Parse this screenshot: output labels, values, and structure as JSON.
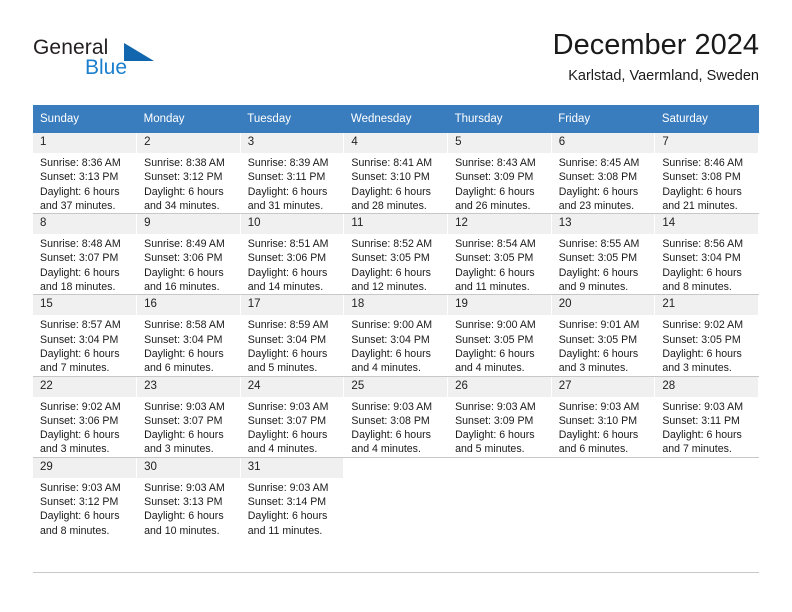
{
  "brand": {
    "name_top": "General",
    "name_bottom": "Blue",
    "color_blue": "#1b7fce",
    "color_triangle": "#1266ad",
    "color_dark": "#231f20"
  },
  "header": {
    "title": "December 2024",
    "location": "Karlstad, Vaermland, Sweden"
  },
  "theme": {
    "header_row_bg": "#3a7dbf",
    "header_row_text": "#ffffff",
    "daynum_bg": "#f0f0f0",
    "grid_line": "#c8c8c8"
  },
  "calendar": {
    "weekday_headers": [
      "Sunday",
      "Monday",
      "Tuesday",
      "Wednesday",
      "Thursday",
      "Friday",
      "Saturday"
    ],
    "labels": {
      "sunrise": "Sunrise:",
      "sunset": "Sunset:",
      "daylight": "Daylight:"
    },
    "weeks": [
      [
        {
          "day": "1",
          "sunrise": "Sunrise: 8:36 AM",
          "sunset": "Sunset: 3:13 PM",
          "daylight_1": "Daylight: 6 hours",
          "daylight_2": "and 37 minutes."
        },
        {
          "day": "2",
          "sunrise": "Sunrise: 8:38 AM",
          "sunset": "Sunset: 3:12 PM",
          "daylight_1": "Daylight: 6 hours",
          "daylight_2": "and 34 minutes."
        },
        {
          "day": "3",
          "sunrise": "Sunrise: 8:39 AM",
          "sunset": "Sunset: 3:11 PM",
          "daylight_1": "Daylight: 6 hours",
          "daylight_2": "and 31 minutes."
        },
        {
          "day": "4",
          "sunrise": "Sunrise: 8:41 AM",
          "sunset": "Sunset: 3:10 PM",
          "daylight_1": "Daylight: 6 hours",
          "daylight_2": "and 28 minutes."
        },
        {
          "day": "5",
          "sunrise": "Sunrise: 8:43 AM",
          "sunset": "Sunset: 3:09 PM",
          "daylight_1": "Daylight: 6 hours",
          "daylight_2": "and 26 minutes."
        },
        {
          "day": "6",
          "sunrise": "Sunrise: 8:45 AM",
          "sunset": "Sunset: 3:08 PM",
          "daylight_1": "Daylight: 6 hours",
          "daylight_2": "and 23 minutes."
        },
        {
          "day": "7",
          "sunrise": "Sunrise: 8:46 AM",
          "sunset": "Sunset: 3:08 PM",
          "daylight_1": "Daylight: 6 hours",
          "daylight_2": "and 21 minutes."
        }
      ],
      [
        {
          "day": "8",
          "sunrise": "Sunrise: 8:48 AM",
          "sunset": "Sunset: 3:07 PM",
          "daylight_1": "Daylight: 6 hours",
          "daylight_2": "and 18 minutes."
        },
        {
          "day": "9",
          "sunrise": "Sunrise: 8:49 AM",
          "sunset": "Sunset: 3:06 PM",
          "daylight_1": "Daylight: 6 hours",
          "daylight_2": "and 16 minutes."
        },
        {
          "day": "10",
          "sunrise": "Sunrise: 8:51 AM",
          "sunset": "Sunset: 3:06 PM",
          "daylight_1": "Daylight: 6 hours",
          "daylight_2": "and 14 minutes."
        },
        {
          "day": "11",
          "sunrise": "Sunrise: 8:52 AM",
          "sunset": "Sunset: 3:05 PM",
          "daylight_1": "Daylight: 6 hours",
          "daylight_2": "and 12 minutes."
        },
        {
          "day": "12",
          "sunrise": "Sunrise: 8:54 AM",
          "sunset": "Sunset: 3:05 PM",
          "daylight_1": "Daylight: 6 hours",
          "daylight_2": "and 11 minutes."
        },
        {
          "day": "13",
          "sunrise": "Sunrise: 8:55 AM",
          "sunset": "Sunset: 3:05 PM",
          "daylight_1": "Daylight: 6 hours",
          "daylight_2": "and 9 minutes."
        },
        {
          "day": "14",
          "sunrise": "Sunrise: 8:56 AM",
          "sunset": "Sunset: 3:04 PM",
          "daylight_1": "Daylight: 6 hours",
          "daylight_2": "and 8 minutes."
        }
      ],
      [
        {
          "day": "15",
          "sunrise": "Sunrise: 8:57 AM",
          "sunset": "Sunset: 3:04 PM",
          "daylight_1": "Daylight: 6 hours",
          "daylight_2": "and 7 minutes."
        },
        {
          "day": "16",
          "sunrise": "Sunrise: 8:58 AM",
          "sunset": "Sunset: 3:04 PM",
          "daylight_1": "Daylight: 6 hours",
          "daylight_2": "and 6 minutes."
        },
        {
          "day": "17",
          "sunrise": "Sunrise: 8:59 AM",
          "sunset": "Sunset: 3:04 PM",
          "daylight_1": "Daylight: 6 hours",
          "daylight_2": "and 5 minutes."
        },
        {
          "day": "18",
          "sunrise": "Sunrise: 9:00 AM",
          "sunset": "Sunset: 3:04 PM",
          "daylight_1": "Daylight: 6 hours",
          "daylight_2": "and 4 minutes."
        },
        {
          "day": "19",
          "sunrise": "Sunrise: 9:00 AM",
          "sunset": "Sunset: 3:05 PM",
          "daylight_1": "Daylight: 6 hours",
          "daylight_2": "and 4 minutes."
        },
        {
          "day": "20",
          "sunrise": "Sunrise: 9:01 AM",
          "sunset": "Sunset: 3:05 PM",
          "daylight_1": "Daylight: 6 hours",
          "daylight_2": "and 3 minutes."
        },
        {
          "day": "21",
          "sunrise": "Sunrise: 9:02 AM",
          "sunset": "Sunset: 3:05 PM",
          "daylight_1": "Daylight: 6 hours",
          "daylight_2": "and 3 minutes."
        }
      ],
      [
        {
          "day": "22",
          "sunrise": "Sunrise: 9:02 AM",
          "sunset": "Sunset: 3:06 PM",
          "daylight_1": "Daylight: 6 hours",
          "daylight_2": "and 3 minutes."
        },
        {
          "day": "23",
          "sunrise": "Sunrise: 9:03 AM",
          "sunset": "Sunset: 3:07 PM",
          "daylight_1": "Daylight: 6 hours",
          "daylight_2": "and 3 minutes."
        },
        {
          "day": "24",
          "sunrise": "Sunrise: 9:03 AM",
          "sunset": "Sunset: 3:07 PM",
          "daylight_1": "Daylight: 6 hours",
          "daylight_2": "and 4 minutes."
        },
        {
          "day": "25",
          "sunrise": "Sunrise: 9:03 AM",
          "sunset": "Sunset: 3:08 PM",
          "daylight_1": "Daylight: 6 hours",
          "daylight_2": "and 4 minutes."
        },
        {
          "day": "26",
          "sunrise": "Sunrise: 9:03 AM",
          "sunset": "Sunset: 3:09 PM",
          "daylight_1": "Daylight: 6 hours",
          "daylight_2": "and 5 minutes."
        },
        {
          "day": "27",
          "sunrise": "Sunrise: 9:03 AM",
          "sunset": "Sunset: 3:10 PM",
          "daylight_1": "Daylight: 6 hours",
          "daylight_2": "and 6 minutes."
        },
        {
          "day": "28",
          "sunrise": "Sunrise: 9:03 AM",
          "sunset": "Sunset: 3:11 PM",
          "daylight_1": "Daylight: 6 hours",
          "daylight_2": "and 7 minutes."
        }
      ],
      [
        {
          "day": "29",
          "sunrise": "Sunrise: 9:03 AM",
          "sunset": "Sunset: 3:12 PM",
          "daylight_1": "Daylight: 6 hours",
          "daylight_2": "and 8 minutes."
        },
        {
          "day": "30",
          "sunrise": "Sunrise: 9:03 AM",
          "sunset": "Sunset: 3:13 PM",
          "daylight_1": "Daylight: 6 hours",
          "daylight_2": "and 10 minutes."
        },
        {
          "day": "31",
          "sunrise": "Sunrise: 9:03 AM",
          "sunset": "Sunset: 3:14 PM",
          "daylight_1": "Daylight: 6 hours",
          "daylight_2": "and 11 minutes."
        },
        {
          "day": "",
          "sunrise": "",
          "sunset": "",
          "daylight_1": "",
          "daylight_2": ""
        },
        {
          "day": "",
          "sunrise": "",
          "sunset": "",
          "daylight_1": "",
          "daylight_2": ""
        },
        {
          "day": "",
          "sunrise": "",
          "sunset": "",
          "daylight_1": "",
          "daylight_2": ""
        },
        {
          "day": "",
          "sunrise": "",
          "sunset": "",
          "daylight_1": "",
          "daylight_2": ""
        }
      ]
    ]
  }
}
